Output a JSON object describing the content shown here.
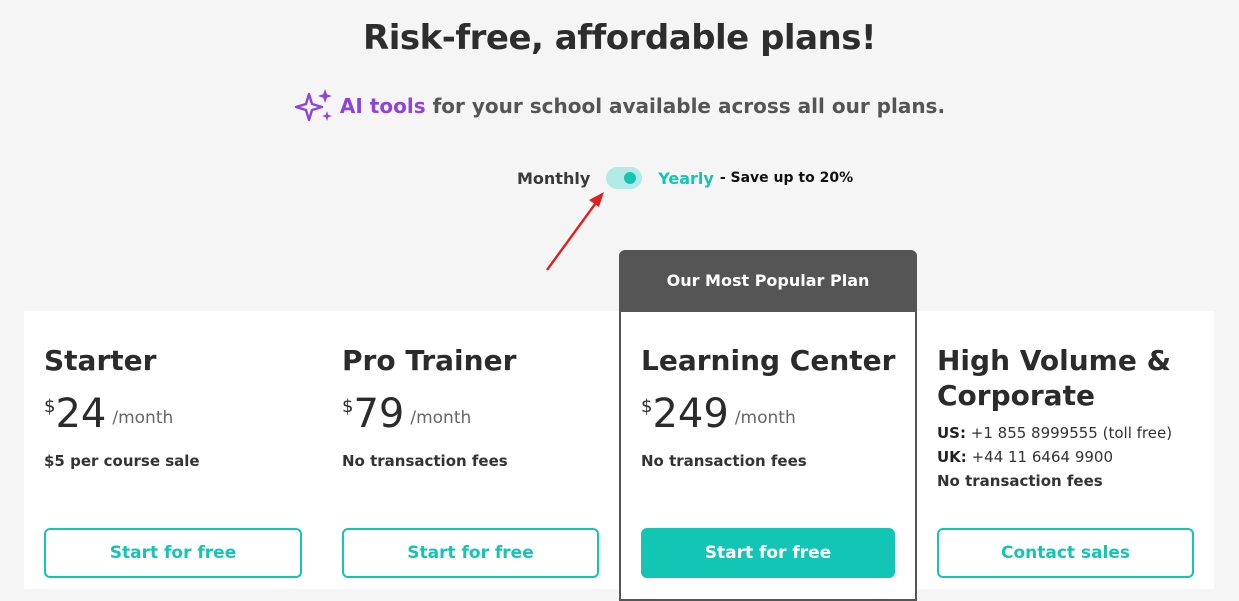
{
  "page": {
    "title": "Risk-free, affordable plans!",
    "subtitle_highlight": "AI tools",
    "subtitle_rest": "for your school available across all our plans."
  },
  "billing": {
    "monthly_label": "Monthly",
    "yearly_label": "Yearly",
    "save_label": "- Save up to 20%",
    "selected": "Yearly"
  },
  "popular_label": "Our Most Popular Plan",
  "plans": [
    {
      "name": "Starter",
      "currency": "$",
      "price": "24",
      "period": "/month",
      "note": "$5 per course sale",
      "button": "Start for free"
    },
    {
      "name": "Pro Trainer",
      "currency": "$",
      "price": "79",
      "period": "/month",
      "note": "No transaction fees",
      "button": "Start for free"
    },
    {
      "name": "Learning Center",
      "currency": "$",
      "price": "249",
      "period": "/month",
      "note": "No transaction fees",
      "button": "Start for free"
    },
    {
      "name_line1": "High Volume &",
      "name_line2": "Corporate",
      "us_label": "US:",
      "us_phone": "+1 855 8999555 (toll free)",
      "uk_label": "UK:",
      "uk_phone": "+44 11 6464 9900",
      "note": "No transaction fees",
      "button": "Contact sales"
    }
  ],
  "colors": {
    "accent": "#12c5b5",
    "ai_purple": "#8e44d9",
    "popular_header": "#555555",
    "annotation_arrow": "#e02020"
  },
  "icons": {
    "ai": "sparkle-icon",
    "annotation": "red-arrow"
  }
}
